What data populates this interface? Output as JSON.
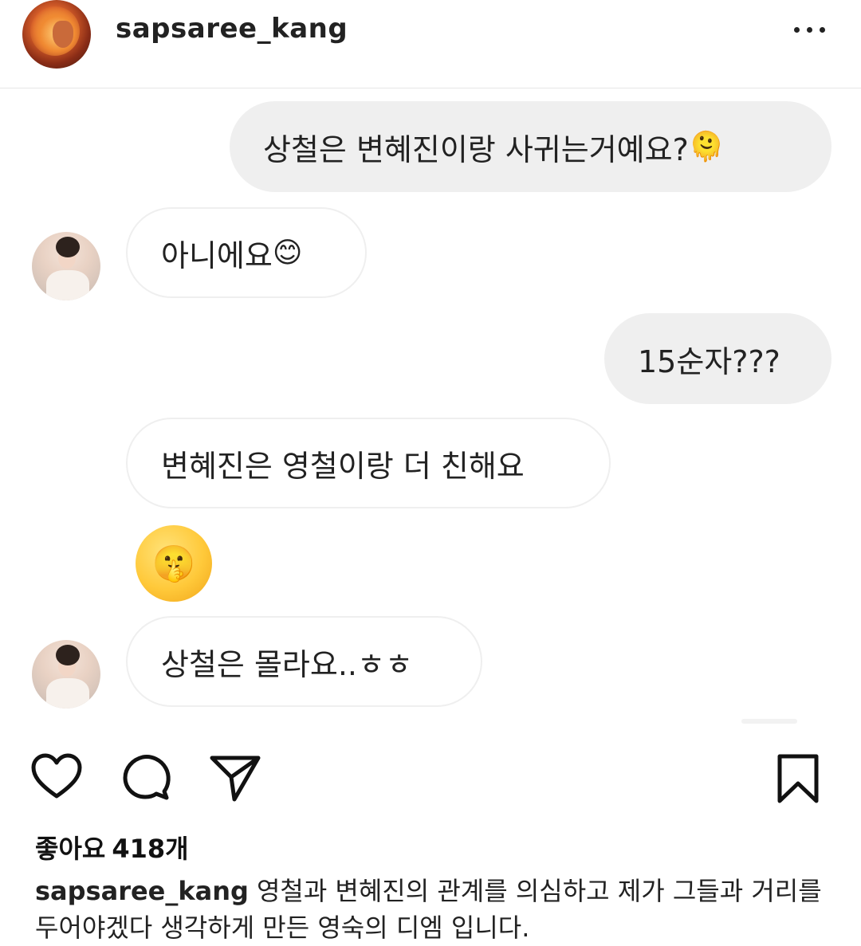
{
  "header": {
    "username": "sapsaree_kang",
    "avatar_icon": "lion-avatar",
    "more_icon": "more-horizontal-icon"
  },
  "chat": {
    "messages": [
      {
        "direction": "outgoing",
        "text": "상철은 변혜진이랑 사귀는거예요?",
        "emoji": "🫠"
      },
      {
        "direction": "incoming",
        "text": "아니에요",
        "emoji": "😊"
      },
      {
        "direction": "outgoing",
        "text": "15순자???"
      },
      {
        "direction": "incoming",
        "text": "변혜진은 영철이랑 더 친해요"
      },
      {
        "direction": "incoming",
        "emoji_only": "🤫"
      },
      {
        "direction": "incoming",
        "text": "상철은 몰라요..ㅎㅎ"
      }
    ]
  },
  "actions": {
    "like_icon": "heart-icon",
    "comment_icon": "comment-icon",
    "share_icon": "send-icon",
    "save_icon": "bookmark-icon"
  },
  "post": {
    "likes_label": "좋아요",
    "likes_count": "418개",
    "caption_user": "sapsaree_kang",
    "caption_text": "영철과 변혜진의 관계를 의심하고 제가 그들과 거리를 두어야겠다 생각하게 만든 영숙의 디엠 입니다."
  }
}
